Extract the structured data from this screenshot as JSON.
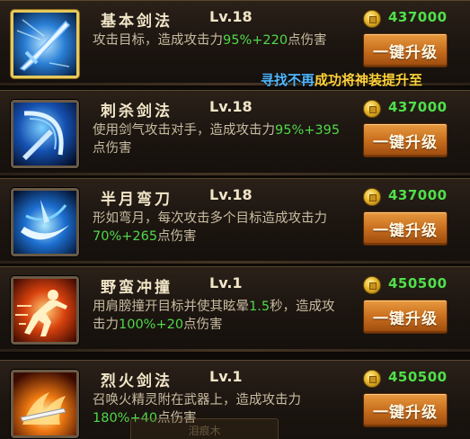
{
  "skills": [
    {
      "name": "基本剑法",
      "level": "Lv.18",
      "desc_pre": "攻击目标，造成攻击力",
      "desc_a": "95%+220",
      "desc_mid": "点伤害",
      "desc_b": "",
      "desc_post": "",
      "cost": "437000",
      "button": "一键升级",
      "selected": true,
      "icon": "sword-thrust-icon"
    },
    {
      "name": "刺杀剑法",
      "level": "Lv.18",
      "desc_pre": "使用剑气攻击对手，造成攻击力",
      "desc_a": "95%+395",
      "desc_mid": "点伤害",
      "desc_b": "",
      "desc_post": "",
      "cost": "437000",
      "button": "一键升级",
      "selected": false,
      "icon": "sword-slash-icon"
    },
    {
      "name": "半月弯刀",
      "level": "Lv.18",
      "desc_pre": "形如弯月，每次攻击多个目标造成攻击力",
      "desc_a": "70%+265",
      "desc_mid": "点伤害",
      "desc_b": "",
      "desc_post": "",
      "cost": "437000",
      "button": "一键升级",
      "selected": false,
      "icon": "crescent-blade-icon"
    },
    {
      "name": "野蛮冲撞",
      "level": "Lv.1",
      "desc_pre": "用肩膀撞开目标并使其眩晕",
      "desc_a": "1.5",
      "desc_mid": "秒，造成攻击力",
      "desc_b": "100%+20",
      "desc_post": "点伤害",
      "cost": "450500",
      "button": "一键升级",
      "selected": false,
      "icon": "charging-warrior-icon"
    },
    {
      "name": "烈火剑法",
      "level": "Lv.1",
      "desc_pre": "召唤火精灵附在武器上，造成攻击力",
      "desc_a": "180%+40",
      "desc_mid": "点伤害",
      "desc_b": "",
      "desc_post": "",
      "cost": "450500",
      "button": "一键升级",
      "selected": false,
      "icon": "flame-sword-icon"
    }
  ],
  "broadcast": {
    "part1": "寻找不再",
    "part2": "成功将神装提升至"
  },
  "ghost": "泪痕木",
  "colors": {
    "highlight": "#4fd84a",
    "cost": "#4fe04a",
    "button": "#c56a1c",
    "selected_frame": "#e7c85a"
  }
}
